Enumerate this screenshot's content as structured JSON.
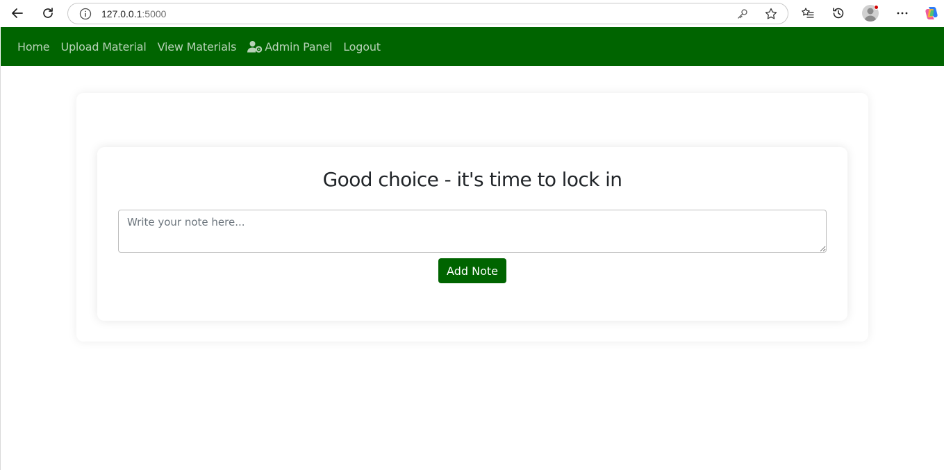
{
  "browser": {
    "url_host": "127.0.0.1",
    "url_port": ":5000"
  },
  "navbar": {
    "bg_color": "#006400",
    "links": [
      {
        "label": "Home"
      },
      {
        "label": "Upload Material"
      },
      {
        "label": "View Materials"
      },
      {
        "label": "Admin Panel",
        "icon": "user-gear-icon"
      },
      {
        "label": "Logout"
      }
    ]
  },
  "main": {
    "heading": "Good choice - it's time to lock in",
    "note_placeholder": "Write your note here...",
    "note_value": "",
    "add_button_label": "Add Note",
    "accent_color": "#006400"
  }
}
